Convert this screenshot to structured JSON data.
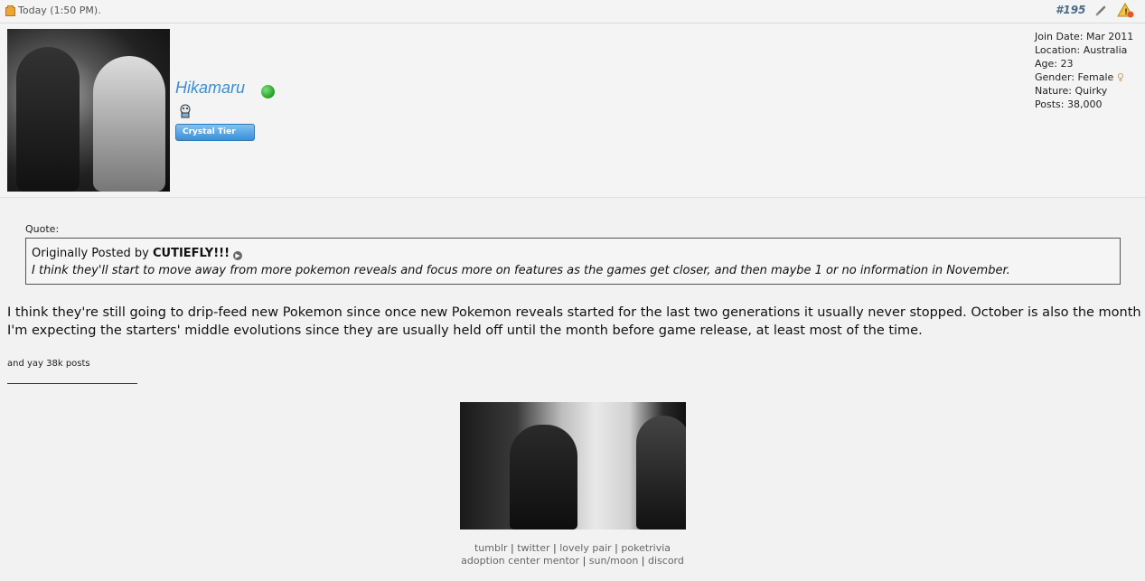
{
  "header": {
    "date": "Today (1:50 PM).",
    "post_number": "#195"
  },
  "user": {
    "name": "Hikamaru",
    "tier": "Crystal Tier",
    "stats": {
      "join_date": "Join Date: Mar 2011",
      "location": "Location: Australia",
      "age": "Age: 23",
      "gender": "Gender: Female",
      "nature": "Nature: Quirky",
      "posts": "Posts: 38,000"
    }
  },
  "quote": {
    "label": "Quote:",
    "prefix": "Originally Posted by",
    "author": "CUTIEFLY!!!",
    "text": "I think they'll start to move away from more pokemon reveals and focus more on features as the games get closer, and then maybe 1 or no information in November."
  },
  "message": {
    "body": "I think they're still going to drip-feed new Pokemon since once new Pokemon reveals started for the last two generations it usually never stopped. October is also the month I'm expecting the starters' middle evolutions since they are usually held off until the month before game release, at least most of the time.",
    "note": "and yay 38k posts"
  },
  "signature": {
    "links_row1": [
      "tumblr",
      "twitter",
      "lovely pair",
      "poketrivia"
    ],
    "links_row2": [
      "adoption center mentor",
      "sun/moon",
      "discord"
    ]
  },
  "colors": {
    "username": "#3b8fd1",
    "tier_badge": "#3a8fd6",
    "online": "#2ea82e"
  }
}
